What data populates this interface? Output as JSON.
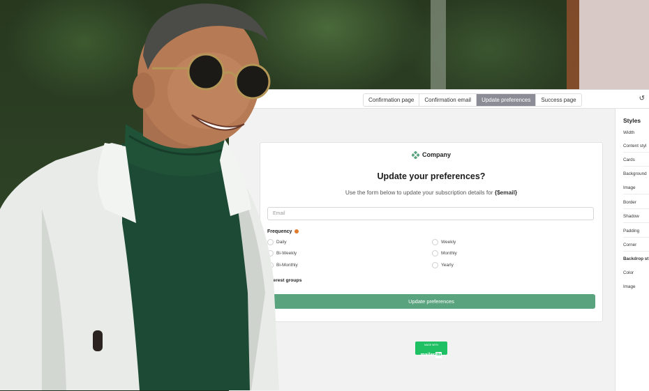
{
  "tabs": [
    {
      "label": "Confirmation page",
      "active": false
    },
    {
      "label": "Confirmation email",
      "active": false
    },
    {
      "label": "Update preferences",
      "active": true
    },
    {
      "label": "Success page",
      "active": false
    }
  ],
  "toolbar": {
    "undo_icon": "undo-icon"
  },
  "card": {
    "brand": "Company",
    "title": "Update your preferences?",
    "subtitle_prefix": "Use the form below to update your subscription details for ",
    "subtitle_var": "{$email}",
    "email_placeholder": "Email",
    "frequency_label": "Frequency",
    "frequency_options_left": [
      "Daily",
      "Bi-Weekly",
      "Bi-Monthly"
    ],
    "frequency_options_right": [
      "Weekly",
      "Monthly",
      "Yearly"
    ],
    "interest_label": "Interest groups",
    "submit_label": "Update preferences"
  },
  "badge": {
    "small": "MADE WITH",
    "brand": "mailer",
    "box": "lite"
  },
  "styles_panel": {
    "title": "Styles",
    "items": [
      "Width",
      "Content styl",
      "Cards",
      "Background",
      "Image",
      "Border",
      "Shadow",
      "Padding",
      "Corner",
      "Backdrop st",
      "Color",
      "Image"
    ]
  },
  "colors": {
    "accent": "#5aa37f",
    "active_tab": "#8c8c96",
    "badge": "#1fbf63",
    "info": "#e07a2c"
  }
}
